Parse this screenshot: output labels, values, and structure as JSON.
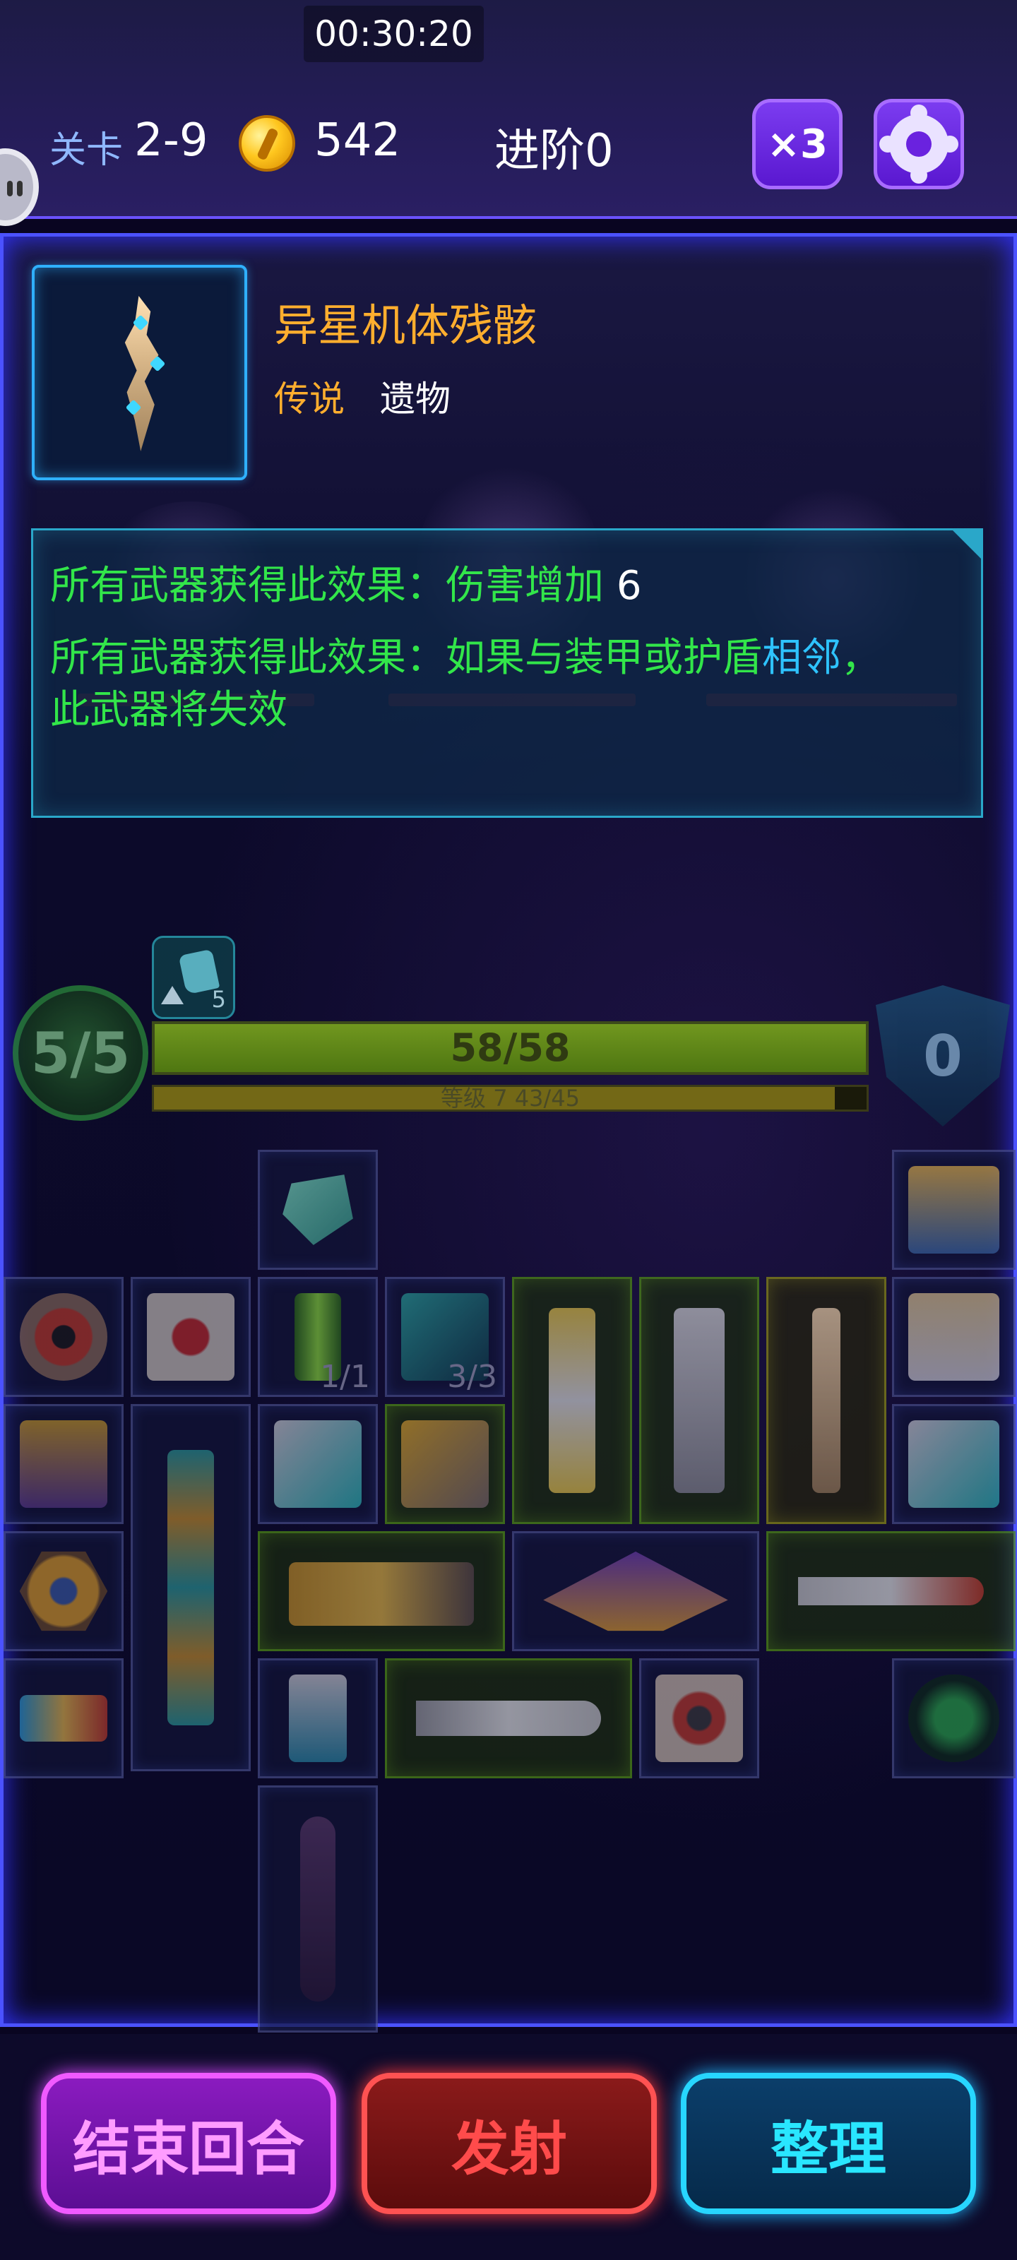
{
  "hud": {
    "timer": "00:30:20",
    "level_label": "关卡",
    "level_value": "2-9",
    "coins": "542",
    "advance": "进阶0",
    "speed": "×3"
  },
  "item": {
    "name": "异星机体残骸",
    "rarity": "传说",
    "type": "遗物",
    "effects": [
      {
        "prefix": "所有武器获得此效果：伤害增加",
        "value": "6"
      },
      {
        "prefix": "所有武器获得此效果：如果与装甲或护盾",
        "keyword": "相邻",
        "suffix": "，",
        "line2": "此武器将失效"
      }
    ]
  },
  "player": {
    "lives": "5/5",
    "fist_count": "5",
    "hp": "58/58",
    "hp_fraction": 1.0,
    "level_text": "等级 7  43/45",
    "xp_fraction": 0.955,
    "shield": "0"
  },
  "inventory": {
    "stack_counts": [
      "1/1",
      "3/3"
    ]
  },
  "buttons": {
    "end_turn": "结束回合",
    "fire": "发射",
    "sort": "整理"
  },
  "colors": {
    "accent": "#4b52ff",
    "legendary": "#ffae2e",
    "effect_text": "#32e64a",
    "keyword": "#2ec3ff"
  }
}
